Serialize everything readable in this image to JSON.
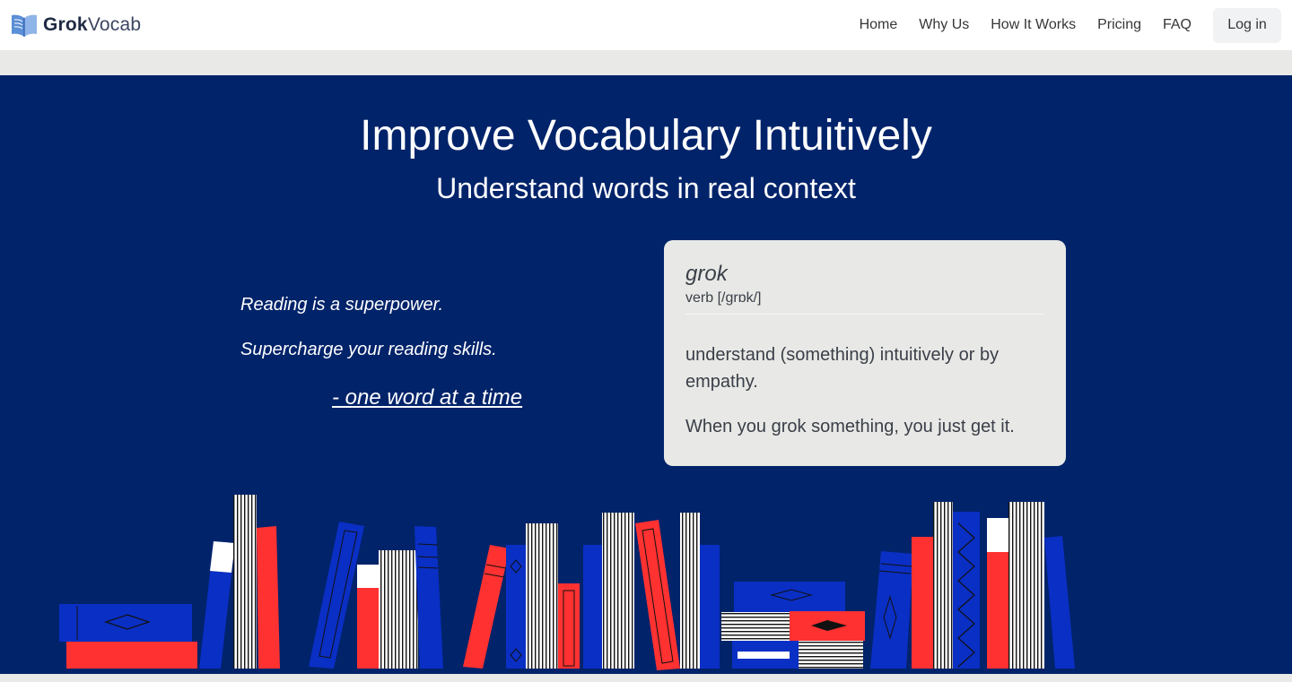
{
  "brand": {
    "name_bold": "Grok",
    "name_light": "Vocab"
  },
  "nav": {
    "links": [
      {
        "label": "Home"
      },
      {
        "label": "Why Us"
      },
      {
        "label": "How It Works"
      },
      {
        "label": "Pricing"
      },
      {
        "label": "FAQ"
      }
    ],
    "login_label": "Log in"
  },
  "hero": {
    "title": "Improve Vocabulary Intuitively",
    "subtitle": "Understand words in real context",
    "tagline_1": "Reading is a superpower.",
    "tagline_2": "Supercharge your reading skills.",
    "tagline_3": "- one word at a time"
  },
  "definition": {
    "word": "grok",
    "part_of_speech": "verb [/grɒk/]",
    "meaning": "understand (something) intuitively or by empathy.",
    "example": "When you grok something, you just get it."
  },
  "colors": {
    "hero_bg": "#00236a",
    "book_blue": "#0a2fc4",
    "book_red": "#ff3131",
    "book_white": "#ffffff"
  }
}
